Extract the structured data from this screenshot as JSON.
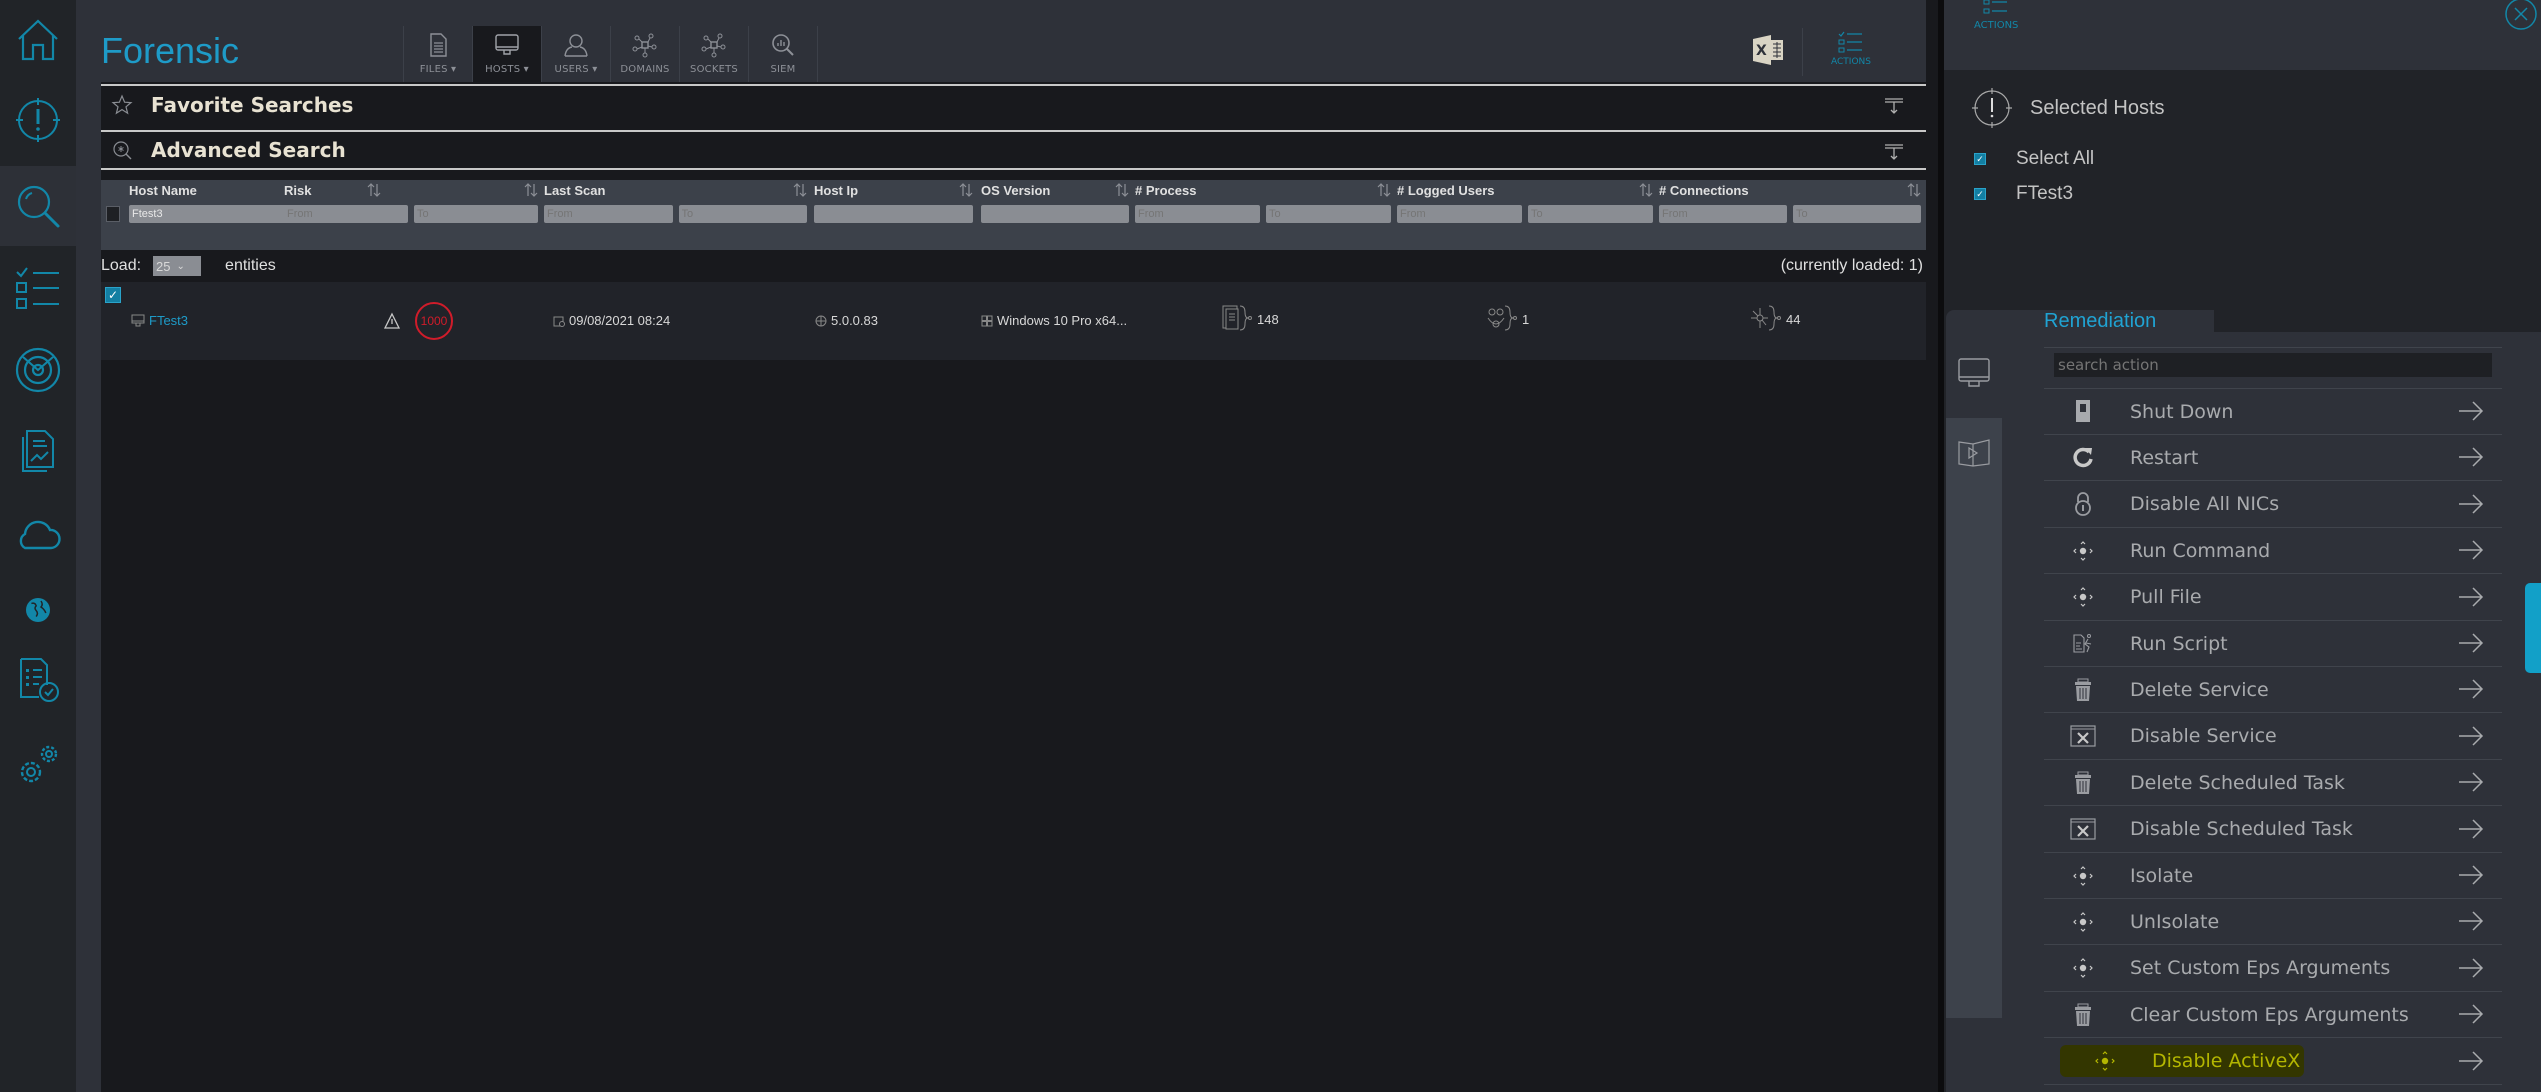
{
  "app": {
    "title": "Forensic"
  },
  "toolbar": {
    "items": [
      {
        "label": "FILES",
        "dropdown": true,
        "icon": "file-icon"
      },
      {
        "label": "HOSTS",
        "dropdown": true,
        "icon": "monitor-icon",
        "active": true
      },
      {
        "label": "USERS",
        "dropdown": true,
        "icon": "user-icon"
      },
      {
        "label": "DOMAINS",
        "dropdown": false,
        "icon": "network-icon"
      },
      {
        "label": "SOCKETS",
        "dropdown": false,
        "icon": "network-icon"
      },
      {
        "label": "SIEM",
        "dropdown": false,
        "icon": "siem-search-icon"
      }
    ],
    "dropdown_glyph": "▾",
    "actions_label": "ACTIONS"
  },
  "sidebar": {
    "items": [
      "home-icon",
      "alert-target-icon",
      "search-icon",
      "checklist-icon",
      "radar-icon",
      "report-icon",
      "cloud-icon",
      "globe-icon",
      "compliance-icon",
      "settings-icon"
    ],
    "active": "search-icon",
    "accent": "#1287a8"
  },
  "searches": {
    "favorite_label": "Favorite Searches",
    "advanced_label": "Advanced Search"
  },
  "filters": {
    "columns": [
      {
        "label": "Host Name",
        "inputs": [
          {
            "value": "Ftest3",
            "placeholder": ""
          }
        ]
      },
      {
        "label": "Risk",
        "inputs": [
          {
            "value": "",
            "placeholder": "From"
          },
          {
            "value": "",
            "placeholder": "To"
          }
        ]
      },
      {
        "label": "Last Scan",
        "inputs": [
          {
            "value": "",
            "placeholder": "From"
          },
          {
            "value": "",
            "placeholder": "To"
          }
        ]
      },
      {
        "label": "Host Ip",
        "inputs": [
          {
            "value": "",
            "placeholder": ""
          }
        ]
      },
      {
        "label": "OS Version",
        "inputs": [
          {
            "value": "",
            "placeholder": ""
          }
        ]
      },
      {
        "label": "# Process",
        "inputs": [
          {
            "value": "",
            "placeholder": "From"
          },
          {
            "value": "",
            "placeholder": "To"
          }
        ]
      },
      {
        "label": "# Logged Users",
        "inputs": [
          {
            "value": "",
            "placeholder": "From"
          },
          {
            "value": "",
            "placeholder": "To"
          }
        ]
      },
      {
        "label": "# Connections",
        "inputs": [
          {
            "value": "",
            "placeholder": "From"
          },
          {
            "value": "",
            "placeholder": "To"
          }
        ]
      }
    ]
  },
  "load": {
    "label": "Load:",
    "value": "25",
    "entities_label": "entities",
    "currently_loaded": "(currently loaded: 1)"
  },
  "rows": [
    {
      "checked": true,
      "host_name": "FTest3",
      "risk": "1000",
      "last_scan": "09/08/2021 08:24",
      "host_ip": "5.0.0.83",
      "os_version": "Windows 10 Pro x64...",
      "process_count": "148",
      "logged_users": "1",
      "connections": "44"
    }
  ],
  "right_panel": {
    "actions_label": "ACTIONS",
    "selected_hosts_title": "Selected Hosts",
    "select_all_label": "Select All",
    "hosts": [
      "FTest3"
    ],
    "remediation": {
      "title": "Remediation",
      "search_placeholder": "search action",
      "actions": [
        {
          "label": "Shut Down",
          "icon": "power-switch-icon"
        },
        {
          "label": "Restart",
          "icon": "restart-icon"
        },
        {
          "label": "Disable All NICs",
          "icon": "lock-icon"
        },
        {
          "label": "Run Command",
          "icon": "move-arrows-icon"
        },
        {
          "label": "Pull File",
          "icon": "move-arrows-icon"
        },
        {
          "label": "Run Script",
          "icon": "script-icon"
        },
        {
          "label": "Delete Service",
          "icon": "trash-icon"
        },
        {
          "label": "Disable Service",
          "icon": "window-x-icon"
        },
        {
          "label": "Delete Scheduled Task",
          "icon": "trash-icon"
        },
        {
          "label": "Disable Scheduled Task",
          "icon": "window-x-icon"
        },
        {
          "label": "Isolate",
          "icon": "move-arrows-icon"
        },
        {
          "label": "UnIsolate",
          "icon": "move-arrows-icon"
        },
        {
          "label": "Set Custom Eps Arguments",
          "icon": "move-arrows-icon"
        },
        {
          "label": "Clear Custom Eps Arguments",
          "icon": "trash-icon"
        },
        {
          "label": "Disable ActiveX",
          "icon": "move-arrows-icon",
          "highlighted": true
        }
      ]
    }
  },
  "colors": {
    "accent": "#1e9bc8",
    "risk": "#d01c2a",
    "highlight": "#b4b600"
  }
}
